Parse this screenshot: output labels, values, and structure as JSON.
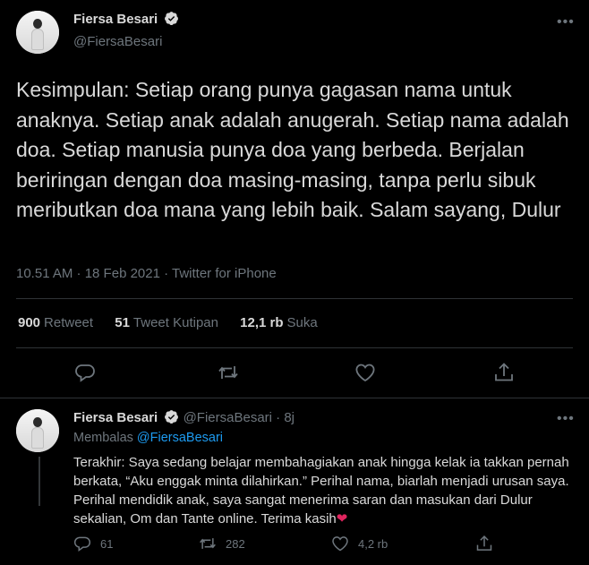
{
  "main": {
    "author_name": "Fiersa Besari",
    "handle": "@FiersaBesari",
    "text": "Kesimpulan: Setiap orang punya gagasan nama untuk anaknya. Setiap anak adalah anugerah. Setiap nama adalah doa. Setiap manusia punya doa yang berbeda. Berjalan beriringan dengan doa masing-masing, tanpa perlu sibuk meributkan doa mana yang lebih baik. Salam sayang, Dulur",
    "timestamp": "10.51 AM · 18 Feb 2021 · Twitter for iPhone",
    "stats": {
      "retweets": "900",
      "retweets_label": "Retweet",
      "quotes": "51",
      "quotes_label": "Tweet Kutipan",
      "likes": "12,1 rb",
      "likes_label": "Suka"
    }
  },
  "reply": {
    "author_name": "Fiersa Besari",
    "handle": "@FiersaBesari",
    "time": "· 8j",
    "replying_prefix": "Membalas",
    "replying_handle": "@FiersaBesari",
    "text": "Terakhir: Saya sedang belajar membahagiakan anak hingga kelak ia takkan pernah berkata, “Aku enggak minta dilahirkan.” Perihal nama, biarlah menjadi urusan saya. Perihal mendidik anak, saya sangat menerima saran dan masukan dari Dulur sekalian, Om dan Tante online. Terima kasih",
    "emoji": "❤",
    "reply_count": "61",
    "retweet_count": "282",
    "like_count": "4,2 rb"
  },
  "icons": {
    "more": "more-icon",
    "verified": "verified-icon",
    "reply": "reply-icon",
    "retweet": "retweet-icon",
    "like": "heart-icon",
    "share": "share-icon"
  },
  "colors": {
    "background": "#000000",
    "text": "#d9d9d9",
    "muted": "#6e767d",
    "accent": "#1d9bf0",
    "divider": "#2f3336",
    "heart": "#e0245e"
  }
}
